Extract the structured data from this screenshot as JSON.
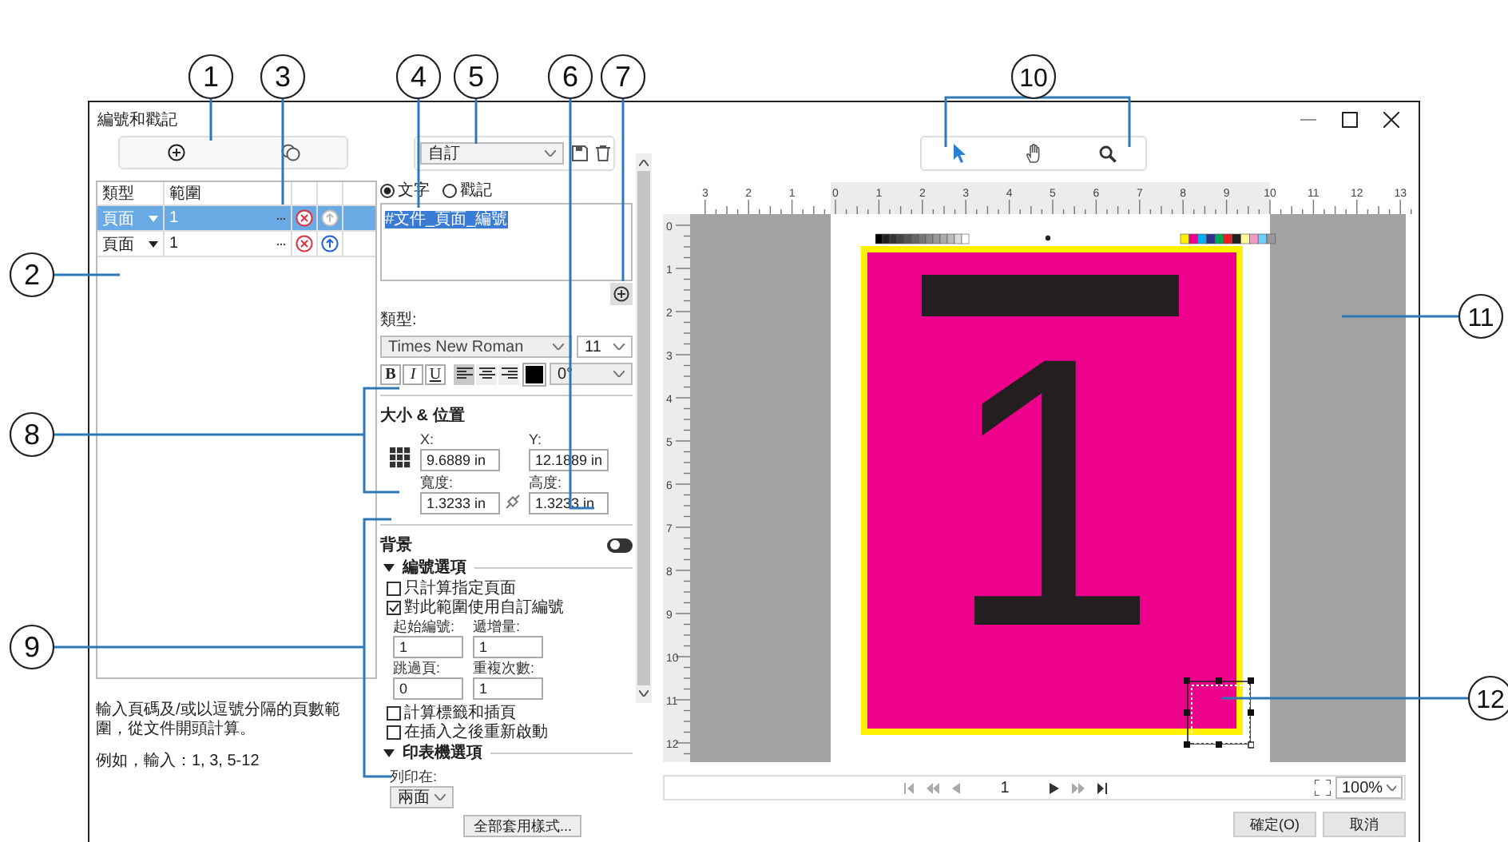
{
  "callouts": [
    "1",
    "2",
    "3",
    "4",
    "5",
    "6",
    "7",
    "8",
    "9",
    "10",
    "11",
    "12"
  ],
  "dialog": {
    "title": "編號和戳記"
  },
  "ranges": {
    "columns": [
      "類型",
      "範圍"
    ],
    "rows": [
      {
        "type": "頁面",
        "range": "1",
        "selected": true,
        "up_disabled": true
      },
      {
        "type": "頁面",
        "range": "1",
        "selected": false,
        "up_disabled": false
      }
    ]
  },
  "help": {
    "text": "輸入頁碼及/或以逗號分隔的頁數範圍，從文件開頭計算。",
    "example": "例如，輸入：1, 3, 5-12"
  },
  "preset": {
    "value": "自訂"
  },
  "modes": [
    {
      "label": "文字",
      "selected": true
    },
    {
      "label": "戳記",
      "selected": false
    }
  ],
  "text_content": "#文件_頁面_編號",
  "font": {
    "label": "類型:",
    "family": "Times New Roman",
    "size": "11",
    "rotation": "0°",
    "color": "#000000",
    "styles": [
      {
        "label": "B",
        "on": false
      },
      {
        "label": "I",
        "on": false
      },
      {
        "label": "U",
        "on": false
      }
    ],
    "alignments": [
      {
        "kind": "left",
        "selected": true
      },
      {
        "kind": "center",
        "selected": false
      },
      {
        "kind": "right",
        "selected": false
      }
    ]
  },
  "size_position": {
    "title": "大小 & 位置",
    "fields": [
      {
        "label": "X:",
        "value": "9.6889 in"
      },
      {
        "label": "Y:",
        "value": "12.1889 in"
      },
      {
        "label": "寬度:",
        "value": "1.3233 in"
      },
      {
        "label": "高度:",
        "value": "1.3233 in"
      }
    ]
  },
  "background": {
    "label": "背景",
    "on": false
  },
  "numbering": {
    "title": "編號選項",
    "expanded": true,
    "checks": [
      {
        "label": "只計算指定頁面",
        "checked": false
      },
      {
        "label": "對此範圍使用自訂編號",
        "checked": true
      }
    ],
    "fields": [
      {
        "label": "起始編號:",
        "value": "1"
      },
      {
        "label": "遞增量:",
        "value": "1"
      },
      {
        "label": "跳過頁:",
        "value": "0"
      },
      {
        "label": "重複次數:",
        "value": "1"
      }
    ],
    "checks2": [
      {
        "label": "計算標籤和插頁",
        "checked": false
      },
      {
        "label": "在插入之後重新啟動",
        "checked": false
      }
    ]
  },
  "printer": {
    "title": "印表機選項",
    "expanded": true,
    "print_on_label": "列印在:",
    "print_on": "兩面"
  },
  "apply_button": "全部套用樣式...",
  "tools": [
    {
      "kind": "pointer",
      "selected": true
    },
    {
      "kind": "hand",
      "selected": false
    },
    {
      "kind": "zoom",
      "selected": false
    }
  ],
  "rulers": {
    "horizontal": [
      "3",
      "2",
      "1",
      "0",
      "1",
      "2",
      "3",
      "4",
      "5",
      "6",
      "7",
      "8",
      "9",
      "10",
      "11",
      "12",
      "13"
    ],
    "vertical": [
      "0",
      "1",
      "2",
      "3",
      "4",
      "5",
      "6",
      "7",
      "8",
      "9",
      "10",
      "11",
      "12"
    ]
  },
  "preview": {
    "page_number": "1"
  },
  "navigation": {
    "page": "1",
    "zoom": "100%"
  },
  "buttons": [
    "確定(O)",
    "取消"
  ]
}
